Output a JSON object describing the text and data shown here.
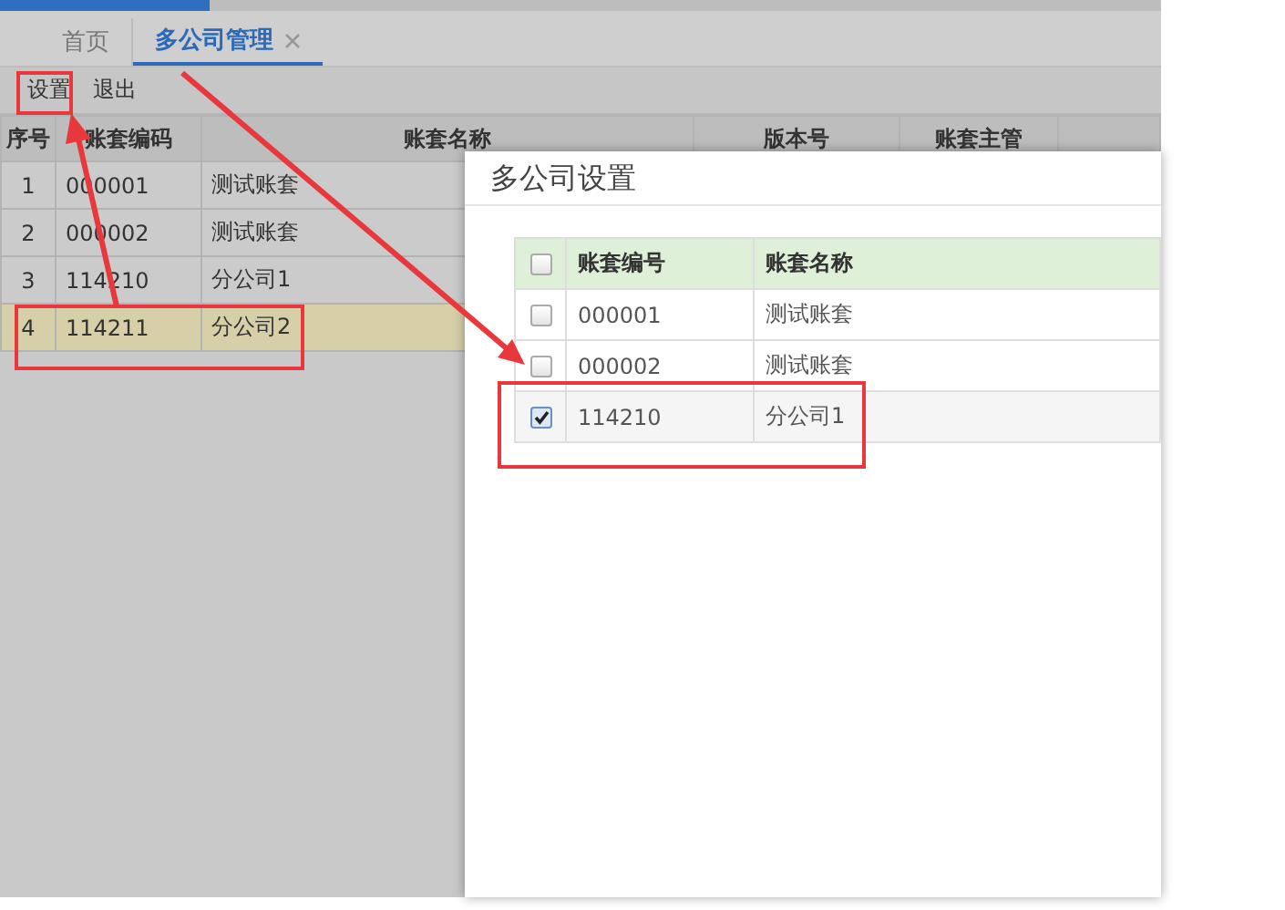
{
  "loading_bar": {
    "level": 0.18
  },
  "tabs": [
    {
      "label": "首页",
      "selected": false,
      "closable": false
    },
    {
      "label": "多公司管理",
      "selected": true,
      "closable": true
    }
  ],
  "toolbar": [
    "设置",
    "退出"
  ],
  "table": {
    "columns": [
      "序号",
      "账套编码",
      "账套名称",
      "版本号",
      "账套主管"
    ],
    "rows": [
      {
        "cells": [
          "1",
          "000001",
          "测试账套"
        ],
        "selected": false
      },
      {
        "cells": [
          "2",
          "000002",
          "测试账套"
        ],
        "selected": false
      },
      {
        "cells": [
          "3",
          "114210",
          "分公司1"
        ],
        "selected": false
      },
      {
        "cells": [
          "4",
          "114211",
          "分公司2"
        ],
        "selected": true
      }
    ]
  },
  "dialog": {
    "title": "多公司设置",
    "header_checked": false,
    "columns": [
      "账套编号",
      "账套名称"
    ],
    "rows": [
      {
        "checked": false,
        "cells": [
          "000001",
          "测试账套"
        ]
      },
      {
        "checked": false,
        "cells": [
          "000002",
          "测试账套"
        ]
      },
      {
        "checked": true,
        "cells": [
          "114210",
          "分公司1"
        ]
      }
    ]
  }
}
